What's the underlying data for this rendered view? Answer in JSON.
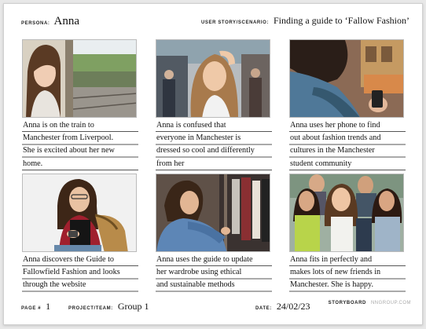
{
  "header": {
    "persona_label": "PERSONA:",
    "persona": "Anna",
    "story_label": "USER STORY/SCENARIO:",
    "story": "Finding a guide to ‘Fallow Fashion’"
  },
  "panels": [
    {
      "lines": [
        "Anna is on the train to",
        "Manchester from Liverpool.",
        "She is excited about her new",
        "home."
      ]
    },
    {
      "lines": [
        "Anna is confused that",
        "everyone in Manchester is",
        "dressed so cool and differently",
        "from her"
      ]
    },
    {
      "lines": [
        "Anna uses her phone to find",
        "out about fashion trends and",
        "cultures in the Manchester",
        "student community"
      ]
    },
    {
      "lines": [
        "Anna discovers the Guide to",
        "Fallowfield Fashion and looks",
        "through the website"
      ]
    },
    {
      "lines": [
        "Anna uses the guide to update",
        "her wardrobe using ethical",
        "and sustainable methods"
      ]
    },
    {
      "lines": [
        "Anna fits in perfectly and",
        "makes lots of new friends in",
        "Manchester. She is happy."
      ]
    }
  ],
  "footer": {
    "page_label": "PAGE #",
    "page": "1",
    "team_label": "PROJECT/TEAM:",
    "team": "Group 1",
    "date_label": "DATE:",
    "date": "24/02/23",
    "storyboard_label": "STORYBOARD",
    "brand": "NNGROUP.COM"
  }
}
